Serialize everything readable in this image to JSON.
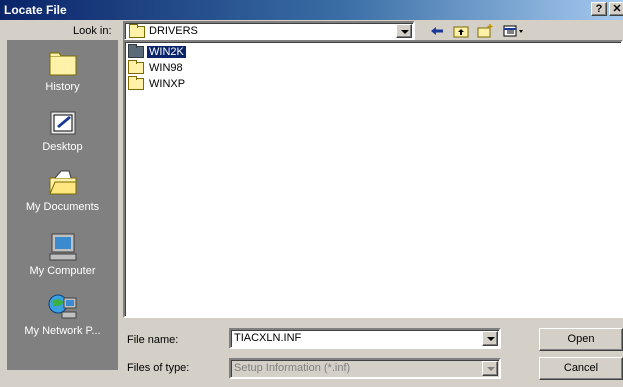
{
  "window": {
    "title": "Locate File",
    "help_label": "?",
    "close_label": "✕"
  },
  "lookin": {
    "label": "Look in:",
    "value": "DRIVERS"
  },
  "toolbar": {
    "back_icon": "back-arrow-icon",
    "up_icon": "up-folder-icon",
    "new_folder_icon": "new-folder-icon",
    "views_icon": "views-menu-icon"
  },
  "places": [
    {
      "label": "History",
      "icon": "history-icon"
    },
    {
      "label": "Desktop",
      "icon": "desktop-icon"
    },
    {
      "label": "My Documents",
      "icon": "my-documents-icon"
    },
    {
      "label": "My Computer",
      "icon": "my-computer-icon"
    },
    {
      "label": "My Network P...",
      "icon": "network-icon"
    }
  ],
  "files": [
    {
      "name": "WIN2K",
      "selected": true
    },
    {
      "name": "WIN98",
      "selected": false
    },
    {
      "name": "WINXP",
      "selected": false
    }
  ],
  "filename": {
    "label": "File name:",
    "value": "TIACXLN.INF"
  },
  "filetype": {
    "label": "Files of type:",
    "value": "Setup Information (*.inf)"
  },
  "buttons": {
    "open": "Open",
    "cancel": "Cancel"
  }
}
